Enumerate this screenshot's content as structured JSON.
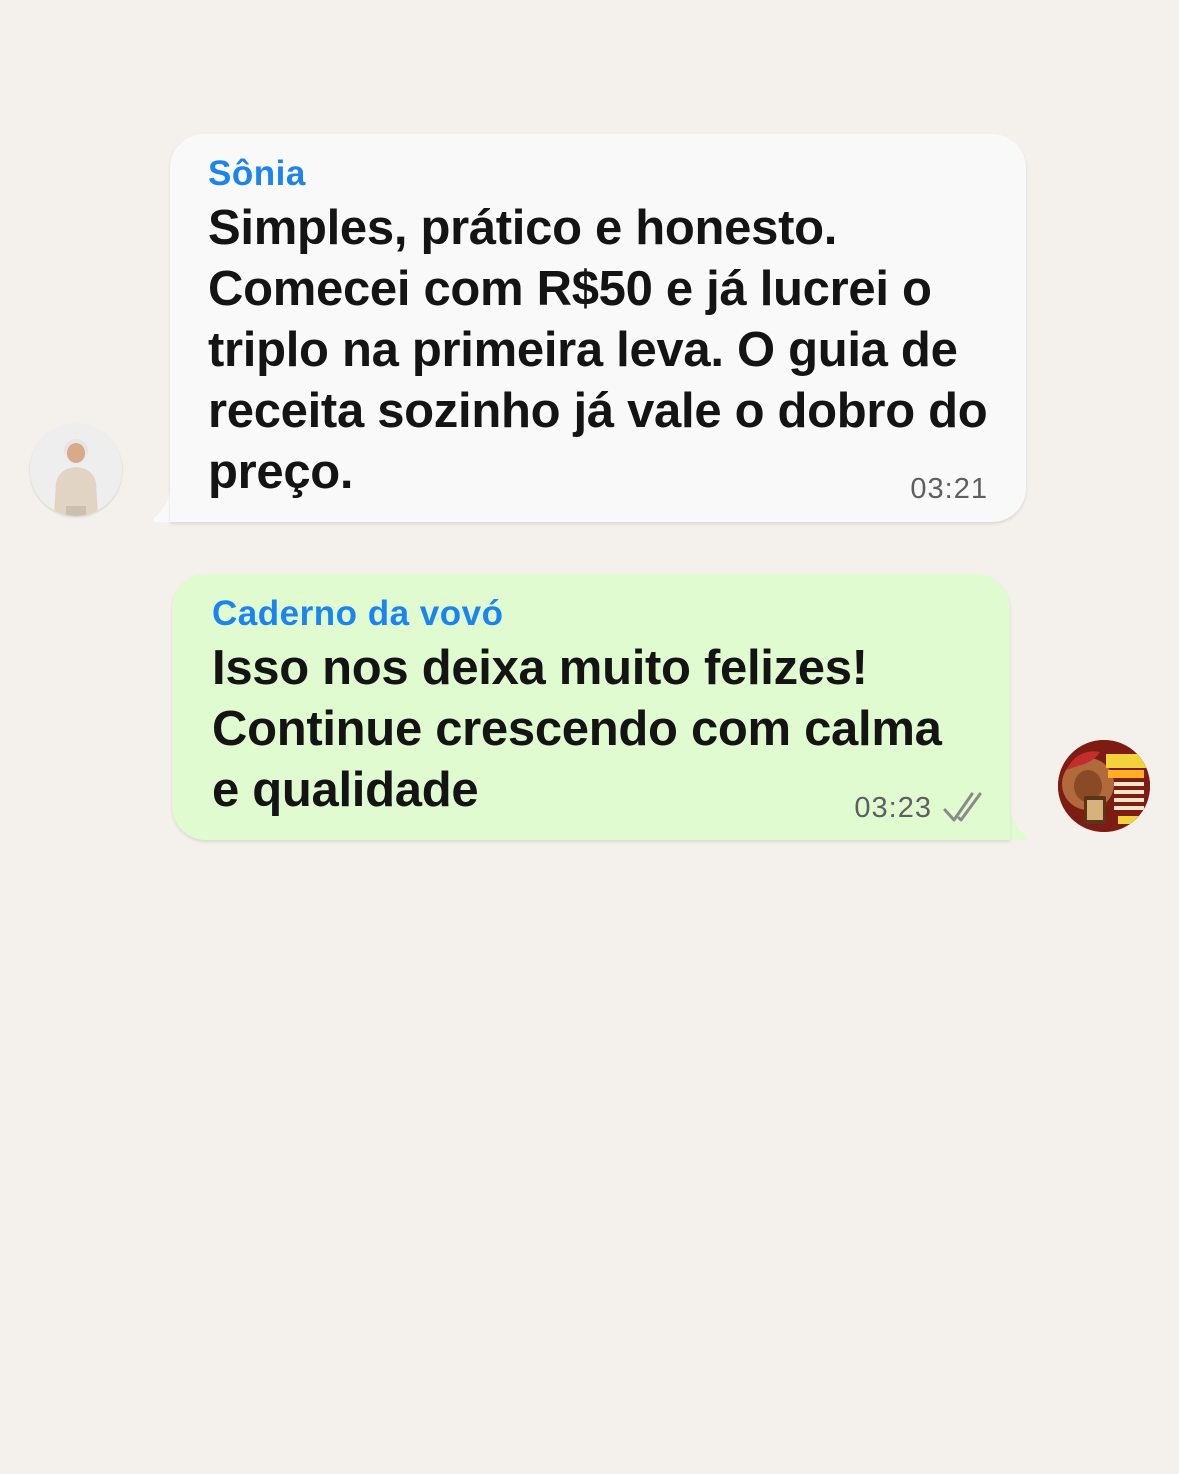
{
  "messages": [
    {
      "direction": "incoming",
      "sender": "Sônia",
      "text": "Simples, prático e honesto. Comecei com R$50 e já lucrei o triplo na primeira leva. O guia de receita sozinho já vale o dobro do preço.",
      "time": "03:21",
      "avatar_icon": "elderly-woman-avatar"
    },
    {
      "direction": "outgoing",
      "sender": "Caderno da vovó",
      "text": "Isso nos deixa muito felizes! Continue crescendo com calma e qualidade",
      "time": "03:23",
      "status_icon": "double-check-read-icon",
      "avatar_icon": "caderno-da-vovo-logo-avatar"
    }
  ],
  "colors": {
    "background": "#f4f1ec",
    "incoming_bubble": "#f9f9f9",
    "outgoing_bubble": "#e1fbd1",
    "sender_name": "#1b84ee",
    "message_text": "#141414",
    "timestamp": "#5f5f5f"
  }
}
